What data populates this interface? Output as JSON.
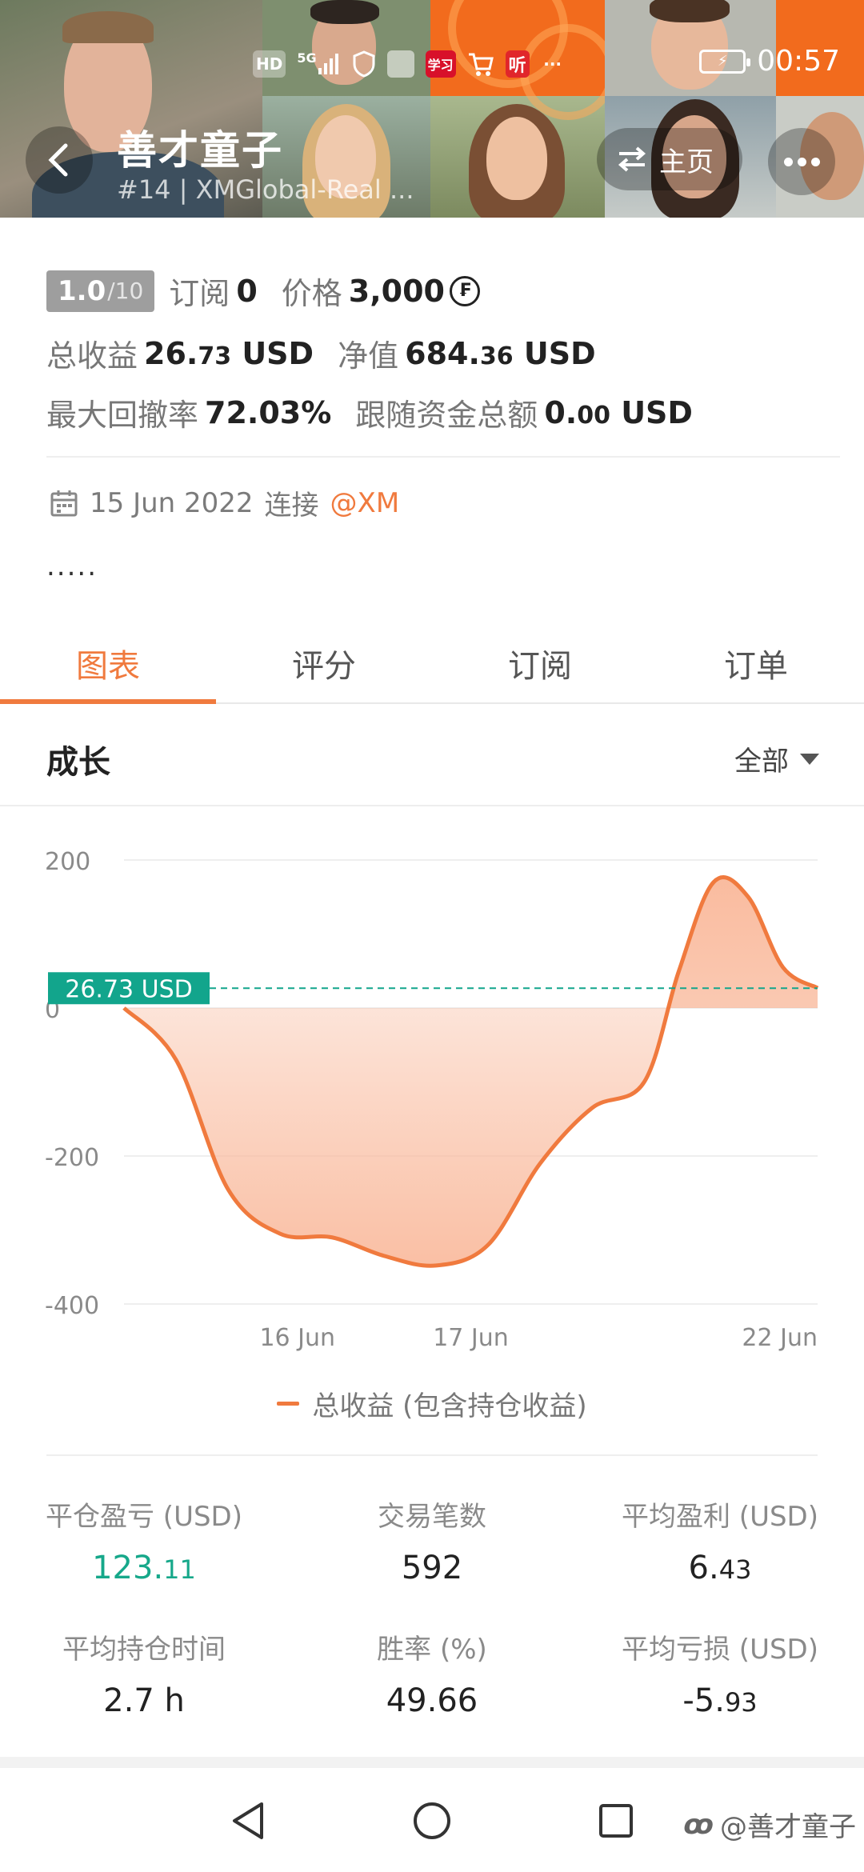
{
  "status_bar": {
    "icons": [
      "hd-icon",
      "5g-signal-icon",
      "shield-app-icon",
      "huawei-app-icon",
      "study-app-icon",
      "cart-app-icon",
      "listen-app-icon",
      "more-dots-icon"
    ],
    "hd": "HD",
    "signal": "5G",
    "study": "学习",
    "listen": "听",
    "more": "···",
    "time": "00:57"
  },
  "header": {
    "name": "善才童子",
    "subtitle": "#14 | XMGlobal-Real ...",
    "home_label": "主页"
  },
  "info": {
    "rating": "1.0",
    "rating_max": "/10",
    "subscribe_label": "订阅",
    "subscribe_value": "0",
    "price_label": "价格",
    "price_value": "3,000",
    "total_profit_label": "总收益",
    "total_profit_int": "26.",
    "total_profit_dec": "73",
    "total_profit_unit": "USD",
    "net_value_label": "净值",
    "net_value_int": "684.",
    "net_value_dec": "36",
    "net_value_unit": "USD",
    "max_drawdown_label": "最大回撤率",
    "max_drawdown_value": "72.03%",
    "follow_funds_label": "跟随资金总额",
    "follow_funds_int": "0.",
    "follow_funds_dec": "00",
    "follow_funds_unit": "USD",
    "connect_date": "15 Jun 2022",
    "connect_label": "连接",
    "broker": "@XM",
    "description": "....."
  },
  "tabs": [
    {
      "label": "图表",
      "active": true
    },
    {
      "label": "评分",
      "active": false
    },
    {
      "label": "订阅",
      "active": false
    },
    {
      "label": "订单",
      "active": false
    }
  ],
  "growth": {
    "title": "成长",
    "range": "全部"
  },
  "chart_data": {
    "type": "area",
    "title": "成长",
    "y_ticks": [
      "200",
      "0",
      "-200",
      "-400"
    ],
    "ylim": [
      -400,
      200
    ],
    "x_ticks": [
      "16 Jun",
      "17 Jun",
      "22 Jun"
    ],
    "x_tick_positions": [
      1.0,
      2.0,
      4.0
    ],
    "xlim": [
      -0.0,
      4.0
    ],
    "current_value_label": "26.73 USD",
    "current_value": 26.73,
    "series": [
      {
        "name": "总收益 (包含持仓收益)",
        "x": [
          0.0,
          0.3,
          0.6,
          0.9,
          1.2,
          1.5,
          1.8,
          2.1,
          2.4,
          2.7,
          3.0,
          3.2,
          3.4,
          3.6,
          3.8,
          4.0
        ],
        "y": [
          0,
          -70,
          -245,
          -305,
          -310,
          -335,
          -348,
          -320,
          -210,
          -135,
          -100,
          50,
          170,
          150,
          55,
          27
        ]
      }
    ],
    "legend": "bottom-center",
    "grid": true,
    "colors": {
      "line": "#f07a3e",
      "fill": "#f9b89a",
      "marker": "#12a58c"
    }
  },
  "stats": [
    {
      "label": "平仓盈亏 (USD)",
      "int": "123.",
      "dec": "11",
      "green": true
    },
    {
      "label": "交易笔数",
      "int": "592",
      "dec": "",
      "green": false
    },
    {
      "label": "平均盈利 (USD)",
      "int": "6.",
      "dec": "43",
      "green": false
    },
    {
      "label": "平均持仓时间",
      "int": "2.7 h",
      "dec": "",
      "green": false
    },
    {
      "label": "胜率 (%)",
      "int": "49.66",
      "dec": "",
      "green": false
    },
    {
      "label": "平均亏损 (USD)",
      "int": "-5.",
      "dec": "93",
      "green": false
    }
  ],
  "watermark": "@善才童子",
  "colors": {
    "accent": "#f07a3e",
    "green": "#16a88a",
    "banner": "#f26b1d"
  }
}
